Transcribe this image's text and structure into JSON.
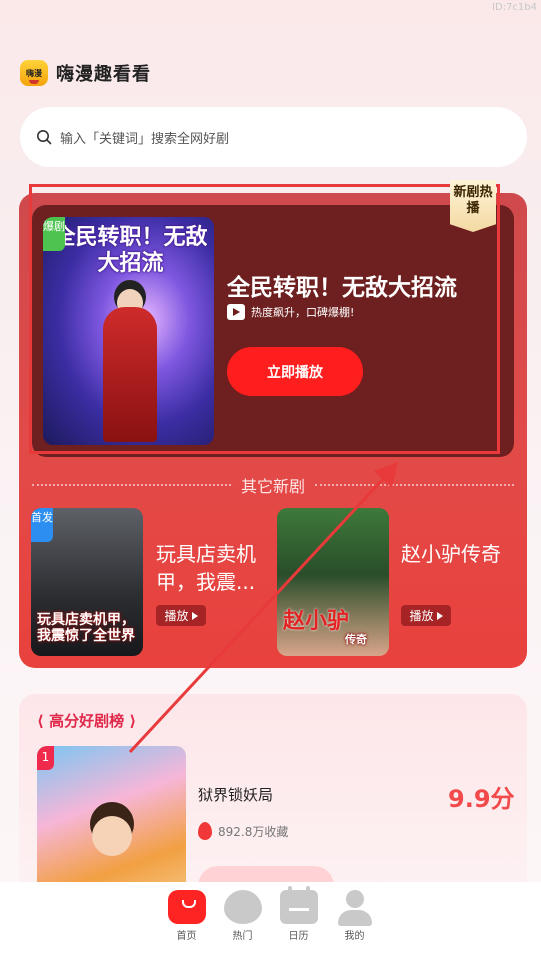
{
  "watermark": "ID:7c1b4",
  "app": {
    "name": "嗨漫趣看看",
    "logo_text": "嗨漫"
  },
  "search": {
    "placeholder": "输入「关键词」搜索全网好剧"
  },
  "featured": {
    "badge": "爆剧",
    "cover_title": "全民转职！无敌大招流",
    "title": "全民转职！无敌大招流",
    "description": "热度飙升，口碑爆棚!",
    "play_label": "立即播放",
    "ribbon": "新剧热播"
  },
  "other_new": {
    "section_label": "其它新剧",
    "items": [
      {
        "badge": "首发",
        "cover_text": "玩具店卖机甲，我震惊了全世界",
        "title": "玩具店卖机甲，我震...",
        "play_label": "播放"
      },
      {
        "cover_text": "赵小驴",
        "cover_sub": "传奇",
        "title": "赵小驴传奇",
        "play_label": "播放"
      }
    ]
  },
  "ranking": {
    "header": "高分好剧榜",
    "items": [
      {
        "rank": "1",
        "title": "狱界锁妖局",
        "favorites": "892.8万收藏",
        "score": "9.9分"
      }
    ]
  },
  "nav": {
    "items": [
      {
        "label": "首页",
        "icon": "home-icon",
        "active": true
      },
      {
        "label": "热门",
        "icon": "hot-icon",
        "active": false
      },
      {
        "label": "日历",
        "icon": "calendar-icon",
        "active": false
      },
      {
        "label": "我的",
        "icon": "profile-icon",
        "active": false
      }
    ]
  },
  "colors": {
    "accent": "#ff1e1e",
    "hero_bg": "#6e1f1f",
    "score": "#f24a4a"
  }
}
